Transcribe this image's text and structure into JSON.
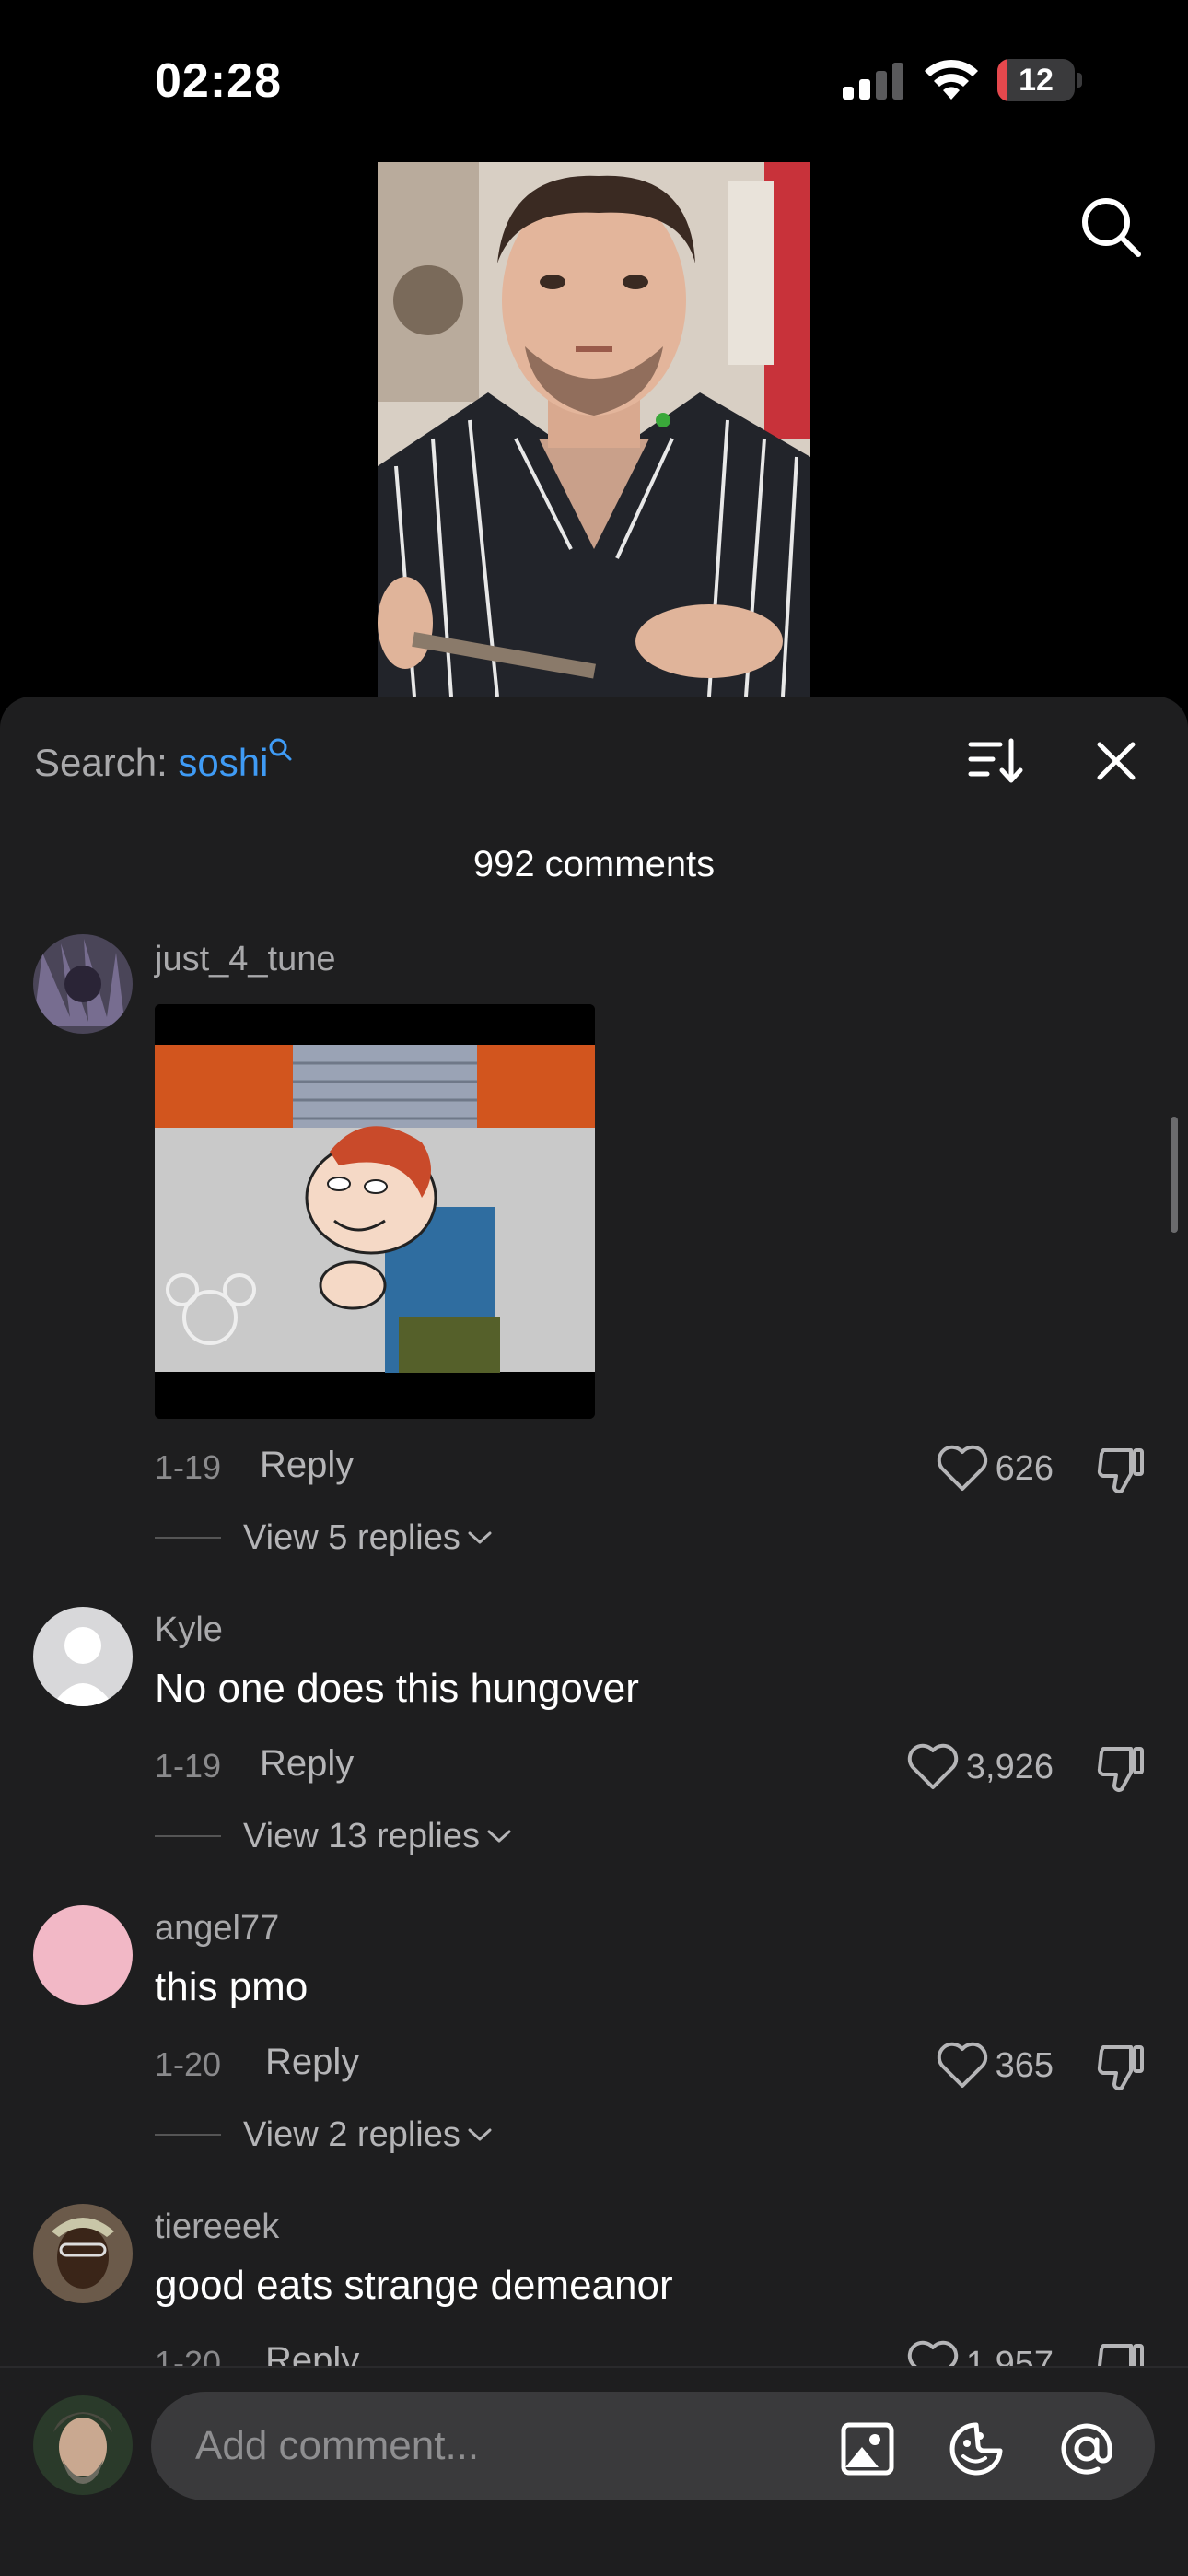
{
  "status_bar": {
    "time": "02:28",
    "battery": "12",
    "battery_level": 0.12
  },
  "search": {
    "prefix": "Search:",
    "term": "soshi"
  },
  "comment_count": "992 comments",
  "comments": [
    {
      "username": "just_4_tune",
      "text": "",
      "has_gif": true,
      "date": "1-19",
      "reply_label": "Reply",
      "likes": "626",
      "view_replies": "View 5 replies"
    },
    {
      "username": "Kyle",
      "text": "No one does this hungover",
      "date": "1-19",
      "reply_label": "Reply",
      "likes": "3,926",
      "view_replies": "View 13 replies"
    },
    {
      "username": "angel77",
      "text": "this pmo",
      "date": "1-20",
      "reply_label": "Reply",
      "likes": "365",
      "view_replies": "View 2 replies"
    },
    {
      "username": "tiereeek",
      "text": "good eats strange demeanor",
      "date": "1-20",
      "reply_label": "Reply",
      "likes": "1,957"
    }
  ],
  "composer": {
    "placeholder": "Add comment..."
  },
  "colors": {
    "sheet_bg": "#1e1e1f",
    "search_term": "#3f9bf5",
    "input_bg": "#3a3a3c",
    "battery_low": "#e5484d"
  },
  "icons": [
    "signal-icon",
    "wifi-icon",
    "battery-icon",
    "search-icon",
    "sort-icon",
    "close-icon",
    "heart-icon",
    "dislike-icon",
    "chevron-down-icon",
    "image-icon",
    "emoji-icon",
    "mention-icon"
  ]
}
